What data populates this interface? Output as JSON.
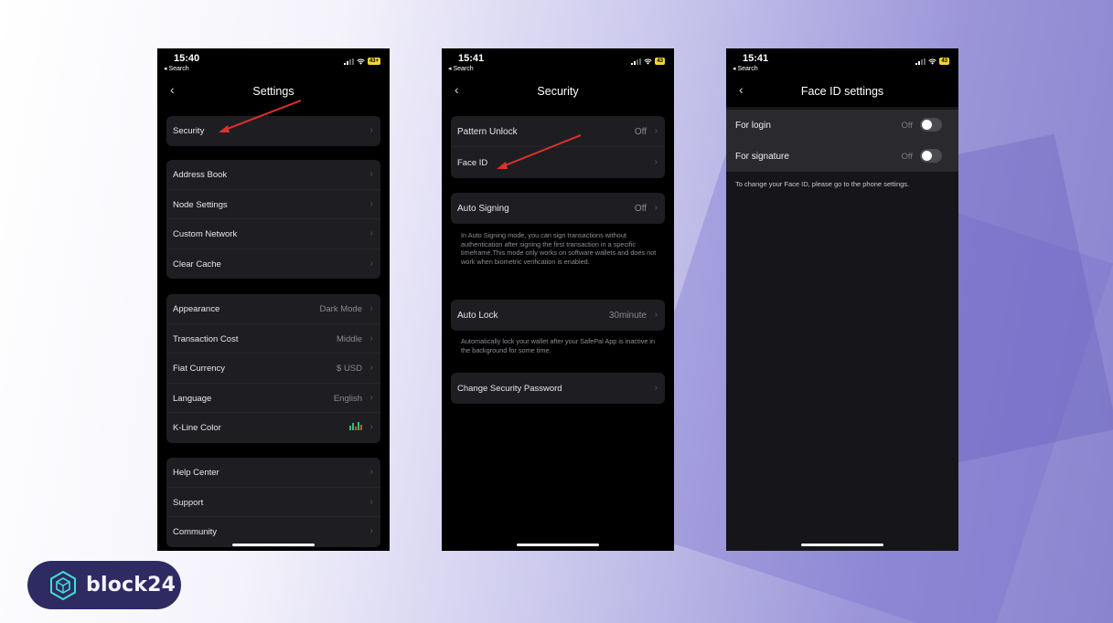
{
  "brand": {
    "name": "block24",
    "accent": "#2e2b63"
  },
  "phone1": {
    "time": "15:40",
    "back_to": "◂ Search",
    "battery": "43+",
    "title": "Settings",
    "group1": [
      {
        "label": "Security",
        "value": ""
      }
    ],
    "group2": [
      {
        "label": "Address Book",
        "value": ""
      },
      {
        "label": "Node Settings",
        "value": ""
      },
      {
        "label": "Custom Network",
        "value": ""
      },
      {
        "label": "Clear Cache",
        "value": ""
      }
    ],
    "group3": [
      {
        "label": "Appearance",
        "value": "Dark Mode"
      },
      {
        "label": "Transaction Cost",
        "value": "Middle"
      },
      {
        "label": "Fiat Currency",
        "value": "$  USD"
      },
      {
        "label": "Language",
        "value": "English"
      },
      {
        "label": "K-Line Color",
        "value": "",
        "icon": "candlestick-icon"
      }
    ],
    "group4": [
      {
        "label": "Help Center",
        "value": ""
      },
      {
        "label": "Support",
        "value": ""
      },
      {
        "label": "Community",
        "value": ""
      }
    ]
  },
  "phone2": {
    "time": "15:41",
    "back_to": "◂ Search",
    "battery": "43",
    "title": "Security",
    "card1": [
      {
        "label": "Pattern Unlock",
        "value": "Off"
      },
      {
        "label": "Face ID",
        "value": ""
      }
    ],
    "auto_signing": {
      "label": "Auto Signing",
      "value": "Off"
    },
    "auto_signing_note": "In Auto Signing mode, you can sign transactions without authentication after signing the first transaction in a specific timeframe.This mode only works on software wallets and does not work when biometric verification is enabled.",
    "auto_lock": {
      "label": "Auto Lock",
      "value": "30minute"
    },
    "auto_lock_note": "Automatically lock your wallet after your SafePal App is inactive in the background for some time.",
    "change_password": {
      "label": "Change Security Password",
      "value": ""
    }
  },
  "phone3": {
    "time": "15:41",
    "back_to": "◂ Search",
    "battery": "43",
    "title": "Face ID settings",
    "for_login": {
      "label": "For login",
      "value": "Off",
      "enabled": false
    },
    "for_signature": {
      "label": "For signature",
      "value": "Off",
      "enabled": false
    },
    "hint": "To change your Face ID, please go to the phone settings."
  },
  "icons": {
    "back": "chevron-left-icon",
    "row_arrow": "chevron-right-icon",
    "annotation": "red-arrow-icon"
  },
  "colors": {
    "arrow": "#e0302b",
    "battery": "#f2d33a"
  }
}
